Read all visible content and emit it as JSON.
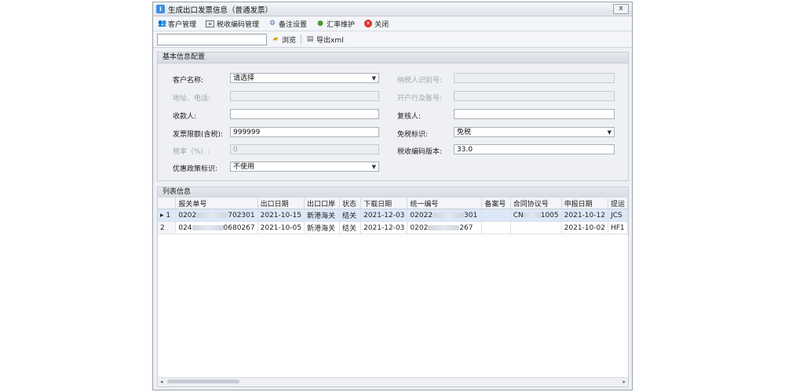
{
  "window": {
    "title": "生成出口发票信息（普通发票）",
    "close_label": "x"
  },
  "toolbar": {
    "items": [
      {
        "label": "客户管理",
        "icon": "customers-icon"
      },
      {
        "label": "税收编码管理",
        "icon": "code-icon"
      },
      {
        "label": "备注设置",
        "icon": "gears-icon"
      },
      {
        "label": "汇率维护",
        "icon": "rate-icon"
      },
      {
        "label": "关闭",
        "icon": "close-icon"
      }
    ],
    "browse": "浏览",
    "export": "导出xml",
    "path_value": ""
  },
  "basic": {
    "title": "基本信息配置",
    "customer_label": "客户名称:",
    "customer_value": "请选择",
    "taxid_label": "纳税人识别号:",
    "address_label": "地址、电话:",
    "bank_label": "开户行及账号:",
    "payee_label": "收款人:",
    "reviewer_label": "复核人:",
    "limit_label": "发票限额(含税):",
    "limit_value": "999999",
    "exempt_label": "免税标识:",
    "exempt_value": "免税",
    "rate_label": "税率（%）:",
    "rate_value": "0",
    "version_label": "税收编码版本:",
    "version_value": "33.0",
    "policy_label": "优惠政策标识:",
    "policy_value": "不使用"
  },
  "list": {
    "title": "列表信息",
    "columns": [
      "报关单号",
      "出口日期",
      "出口口岸",
      "状态",
      "下载日期",
      "统一编号",
      "备案号",
      "合同协议号",
      "申报日期",
      "提运"
    ],
    "rows": [
      {
        "idx": "1",
        "marker": "▸",
        "no_a": "0202",
        "no_b": "702301",
        "date": "2021-10-15",
        "port": "新港海关",
        "status": "结关",
        "dl": "2021-12-03",
        "uni_a": "02022",
        "uni_b": "301",
        "rec": "",
        "contract_a": "CN",
        "contract_b": "1005",
        "decl": "2021-10-12",
        "bl": "JCS"
      },
      {
        "idx": "2",
        "marker": "",
        "no_a": "024",
        "no_b": "0680267",
        "date": "2021-10-05",
        "port": "新港海关",
        "status": "结关",
        "dl": "2021-12-03",
        "uni_a": "0202",
        "uni_b": "267",
        "rec": "",
        "contract_a": "",
        "contract_b": "",
        "decl": "2021-10-02",
        "bl": "HF1"
      }
    ]
  }
}
